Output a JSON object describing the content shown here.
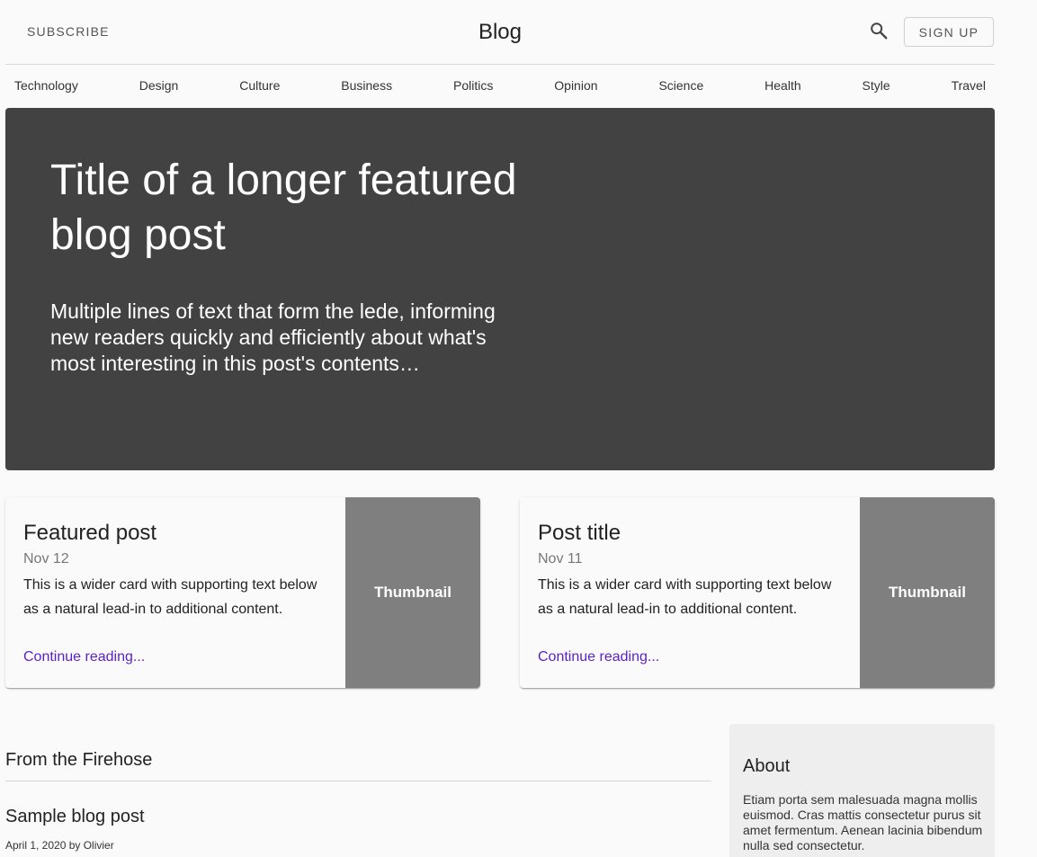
{
  "header": {
    "subscribe_label": "SUBSCRIBE",
    "title": "Blog",
    "search_icon": "search-icon",
    "signup_label": "SIGN UP"
  },
  "sections": [
    "Technology",
    "Design",
    "Culture",
    "Business",
    "Politics",
    "Opinion",
    "Science",
    "Health",
    "Style",
    "Travel"
  ],
  "hero": {
    "title": "Title of a longer featured blog post",
    "lede": "Multiple lines of text that form the lede, informing new readers quickly and efficiently about what's most interesting in this post's contents…"
  },
  "cards": [
    {
      "title": "Featured post",
      "date": "Nov 12",
      "text": "This is a wider card with supporting text below as a natural lead-in to additional content.",
      "link": "Continue reading...",
      "thumb": "Thumbnail"
    },
    {
      "title": "Post title",
      "date": "Nov 11",
      "text": "This is a wider card with supporting text below as a natural lead-in to additional content.",
      "link": "Continue reading...",
      "thumb": "Thumbnail"
    }
  ],
  "main": {
    "heading": "From the Firehose",
    "post_title": "Sample blog post",
    "post_meta": "April 1, 2020 by Olivier"
  },
  "sidebar": {
    "title": "About",
    "text": "Etiam porta sem malesuada magna mollis euismod. Cras mattis consectetur purus sit amet fermentum. Aenean lacinia bibendum nulla sed consectetur."
  },
  "colors": {
    "hero_bg": "#424242",
    "thumb_bg": "#7f7f7f",
    "link": "#5a1fc9",
    "sidebar_bg": "#eeeeee"
  }
}
